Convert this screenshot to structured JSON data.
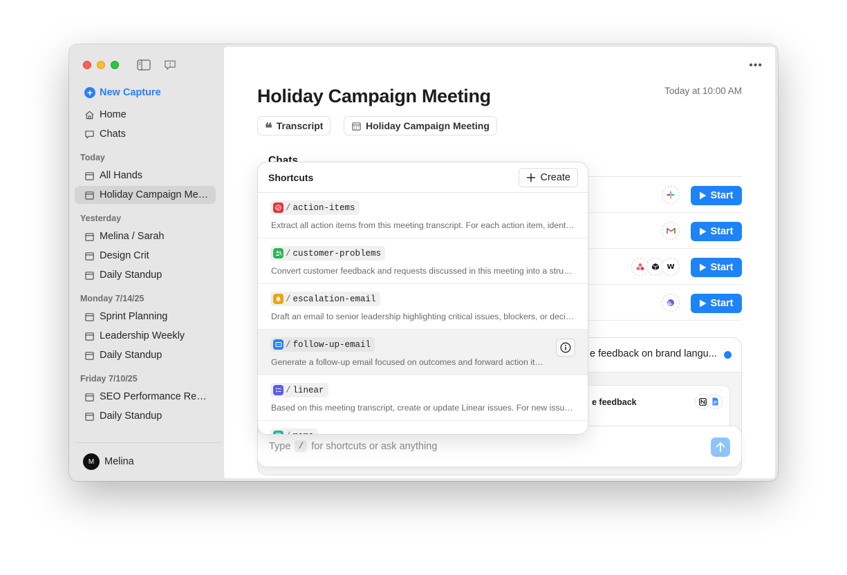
{
  "sidebar": {
    "new_capture": "New Capture",
    "nav": [
      {
        "label": "Home",
        "icon": "house-icon"
      },
      {
        "label": "Chats",
        "icon": "chat-bubble-icon"
      }
    ],
    "sections": [
      {
        "label": "Today",
        "items": [
          "All Hands",
          "Holiday Campaign Meeting"
        ]
      },
      {
        "label": "Yesterday",
        "items": [
          "Melina / Sarah",
          "Design Crit",
          "Daily Standup"
        ]
      },
      {
        "label": "Monday 7/14/25",
        "items": [
          "Sprint Planning",
          "Leadership Weekly",
          "Daily Standup"
        ]
      },
      {
        "label": "Friday 7/10/25",
        "items": [
          "SEO Performance Review",
          "Daily Standup"
        ]
      }
    ],
    "active_item": "Holiday Campaign Meeting",
    "user": {
      "name": "Melina",
      "initial": "M"
    }
  },
  "main": {
    "title": "Holiday Campaign Meeting",
    "timestamp": "Today at 10:00 AM",
    "chips": [
      {
        "label": "Transcript",
        "icon": "quote-icon"
      },
      {
        "label": "Holiday Campaign Meeting",
        "icon": "calendar-icon"
      }
    ],
    "chats_heading": "Chats",
    "chat_rows": [
      {
        "apps": [
          "slack-icon"
        ],
        "button": "Start"
      },
      {
        "apps": [
          "gmail-icon"
        ],
        "button": "Start"
      },
      {
        "apps": [
          "asana-icon",
          "cube-icon",
          "w-icon"
        ],
        "button": "Start"
      },
      {
        "apps": [
          "linear-icon"
        ],
        "button": "Start"
      }
    ],
    "card_text": "e feedback on brand langu...",
    "card_sub_text": "e feedback",
    "card_sub_icons": [
      "notion-icon",
      "google-docs-icon"
    ],
    "composer": {
      "prefix": "Type",
      "key": "/",
      "suffix": "for shortcuts or ask anything"
    }
  },
  "shortcuts": {
    "title": "Shortcuts",
    "create_label": "Create",
    "items": [
      {
        "command": "action-items",
        "color": "#e5343b",
        "description": "Extract all action items from this meeting transcript. For each action item, identify the owner and due date."
      },
      {
        "command": "customer-problems",
        "color": "#2fb55a",
        "description": "Convert customer feedback and requests discussed in this meeting into a structured list of problems."
      },
      {
        "command": "escalation-email",
        "color": "#f0a30a",
        "description": "Draft an email to senior leadership highlighting critical issues, blockers, or decisions needed."
      },
      {
        "command": "follow-up-email",
        "color": "#2b7ef6",
        "description": "Generate a follow-up email focused on outcomes and forward action items.",
        "hover": true
      },
      {
        "command": "linear",
        "color": "#5e5ce6",
        "description": "Based on this meeting transcript, create or update Linear issues. For new issues, include a title."
      },
      {
        "command": "memo",
        "color": "#1fb5a0",
        "description": ""
      }
    ]
  },
  "colors": {
    "accent": "#1e83f7",
    "sidebar_bg": "#e6e6e6",
    "active_item_bg": "#d4d4d4"
  }
}
